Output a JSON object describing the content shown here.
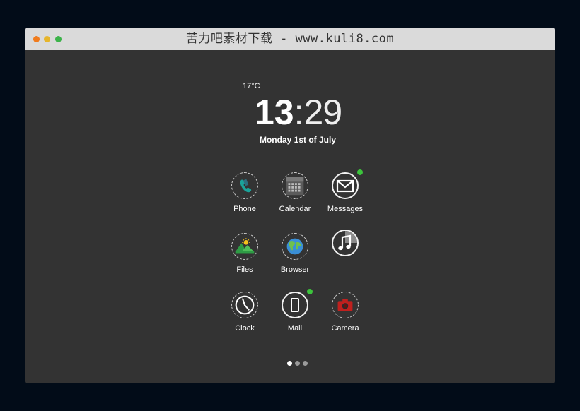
{
  "window": {
    "title": "苦力吧素材下载 - www.kuli8.com",
    "controls": {
      "close_color": "#f07b1d",
      "minimize_color": "#e6b52b",
      "zoom_color": "#3cb34a"
    }
  },
  "lockscreen": {
    "weather": "17°C",
    "time_hours": "13",
    "time_separator": ":",
    "time_minutes": "29",
    "date": "Monday 1st of July"
  },
  "apps": [
    {
      "label": "Phone",
      "icon": "phone-icon"
    },
    {
      "label": "Calendar",
      "icon": "calendar-icon"
    },
    {
      "label": "Messages",
      "icon": "envelope-icon",
      "notification": true
    },
    {
      "label": "Files",
      "icon": "landscape-icon"
    },
    {
      "label": "Browser",
      "icon": "globe-icon"
    },
    {
      "label": "",
      "icon": "music-note-icon"
    },
    {
      "label": "Clock",
      "icon": "clock-icon"
    },
    {
      "label": "Mail",
      "icon": "mobile-device-icon",
      "notification": true
    },
    {
      "label": "Camera",
      "icon": "camera-icon"
    }
  ],
  "pager": {
    "pages": 3,
    "current": 1
  },
  "colors": {
    "background": "#020c18",
    "screen": "#333333",
    "notification": "#3cc43c",
    "phone": "#1aa39a",
    "camera": "#c0201e"
  }
}
